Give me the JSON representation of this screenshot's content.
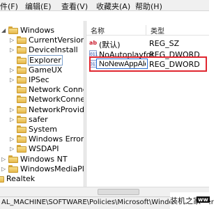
{
  "menu": [
    {
      "label": "件(F)"
    },
    {
      "label": "编辑(E)"
    },
    {
      "label": "查看(V)"
    },
    {
      "label": "收藏夹(A)"
    },
    {
      "label": "帮助(H)"
    }
  ],
  "tree": [
    {
      "label": "Windows",
      "indent": 0,
      "expander": "◢",
      "selected": false
    },
    {
      "label": "CurrentVersion",
      "indent": 1,
      "expander": "▷",
      "selected": false
    },
    {
      "label": "DeviceInstall",
      "indent": 1,
      "expander": "▷",
      "selected": false
    },
    {
      "label": "Explorer",
      "indent": 1,
      "expander": "",
      "selected": true
    },
    {
      "label": "GameUX",
      "indent": 1,
      "expander": "▷",
      "selected": false
    },
    {
      "label": "IPSec",
      "indent": 1,
      "expander": "▷",
      "selected": false
    },
    {
      "label": "Network Connect",
      "indent": 1,
      "expander": "",
      "selected": false
    },
    {
      "label": "NetworkConnectiv",
      "indent": 1,
      "expander": "",
      "selected": false
    },
    {
      "label": "NetworkProvider",
      "indent": 1,
      "expander": "▷",
      "selected": false
    },
    {
      "label": "safer",
      "indent": 1,
      "expander": "▷",
      "selected": false
    },
    {
      "label": "System",
      "indent": 1,
      "expander": "",
      "selected": false
    },
    {
      "label": "Windows Error Re",
      "indent": 1,
      "expander": "▷",
      "selected": false
    },
    {
      "label": "WSDAPI",
      "indent": 1,
      "expander": "▷",
      "selected": false
    },
    {
      "label": "Windows NT",
      "indent": 0,
      "expander": "▷",
      "selected": false
    },
    {
      "label": "WindowsMediaPlaye",
      "indent": 0,
      "expander": "▷",
      "selected": false
    },
    {
      "label": "Realtek",
      "indent": -1,
      "expander": "",
      "selected": false
    }
  ],
  "list": {
    "headers": {
      "name": "名称",
      "type": "类型"
    },
    "rows": [
      {
        "icon": "ab",
        "name": "(默认)",
        "type": "REG_SZ"
      },
      {
        "icon": "bin",
        "name": "NoAutoplayfor...",
        "type": "REG_DWORD"
      },
      {
        "icon": "bin",
        "name": "NoNewAppAlert",
        "type": "REG_DWORD",
        "editing": true
      }
    ]
  },
  "status_path": "AL_MACHINE\\SOFTWARE\\Policies\\Microsoft\\Windows\\Explorer",
  "watermark": {
    "text": "装机之家",
    "badge": "ww"
  },
  "colors": {
    "highlight_border": "#e0262f",
    "edit_border": "#2b6fd2"
  }
}
